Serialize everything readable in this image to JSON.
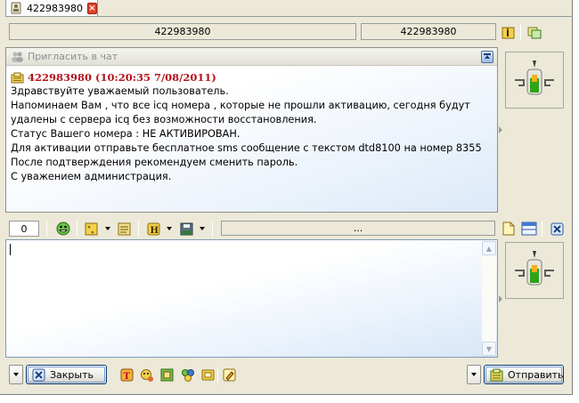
{
  "tab": {
    "title": "422983980",
    "icon": "contact-icon",
    "close_icon": "close-icon"
  },
  "header": {
    "nickname_field": "422983980",
    "uin_field": "422983980",
    "info_button_icon": "user-info-icon",
    "history_button_icon": "history-folder-icon"
  },
  "history": {
    "invite_label": "Пригласить в чат",
    "invite_icon": "invite-users-icon",
    "scroll_icon": "scroll-up-icon",
    "message": {
      "header": "422983980 (10:20:35 7/08/2011)",
      "icon": "message-envelope-icon",
      "lines": [
        "Здравствуйте уважаемый пользователь.",
        "Напоминаем Вам , что все icq номера , которые не прошли активацию, сегодня будут",
        "удалены с сервера icq без возможности восстановления.",
        "Статус Вашего номера : НЕ АКТИВИРОВАН.",
        "Для активации отправьте бесплатное sms сообщение с текстом dtd8100 на номер 8355",
        "После подтверждения рекомендуем сменить пароль.",
        "С уважением администрация."
      ]
    }
  },
  "toolbar": {
    "char_counter": "0",
    "status_field": "...",
    "icons": [
      "smiley-icon",
      "quote-icon",
      "text-format-icon",
      "history-h-icon",
      "save-icon",
      "new-doc-icon",
      "layout-icon",
      "close-x-icon"
    ]
  },
  "input": {
    "value": ""
  },
  "bottom": {
    "close_label": "Закрыть",
    "send_label": "Отправить",
    "icons": [
      "text-t-icon",
      "emoticon-icon",
      "notes-icon",
      "plugins-icon",
      "contact-card-icon",
      "pencil-icon"
    ]
  },
  "colors": {
    "message_header": "#b5111a",
    "panel_bg": "#ece9d8",
    "accent": "#003c74"
  }
}
